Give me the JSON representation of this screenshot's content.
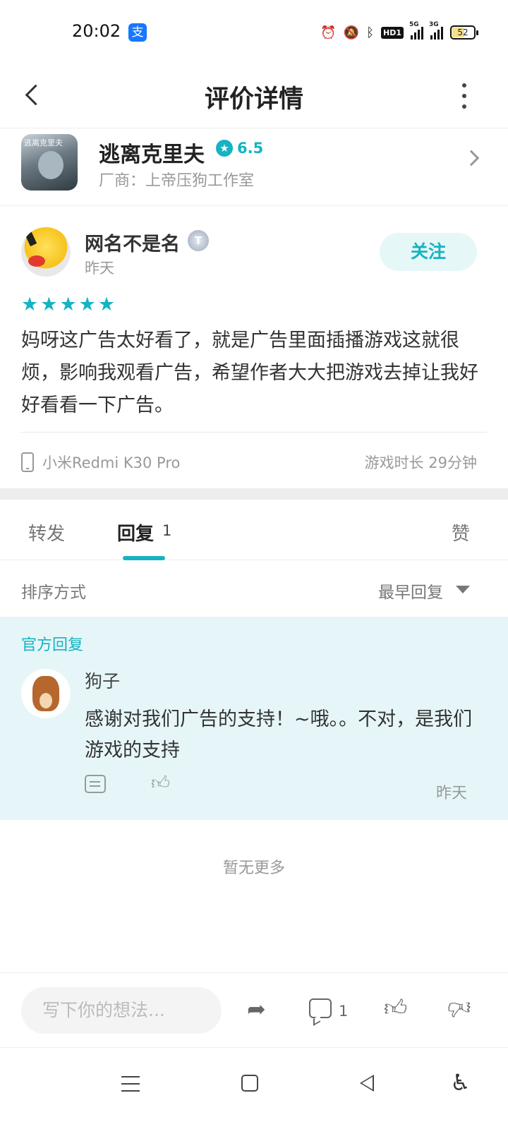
{
  "status_bar": {
    "time": "20:02",
    "app_badge": "支",
    "hd_label": "HD1",
    "sig1_label": "5G",
    "sig2_label": "3G",
    "battery": "52"
  },
  "header": {
    "title": "评价详情"
  },
  "game": {
    "name": "逃离克里夫",
    "rating": "6.5",
    "vendor": "厂商：上帝压狗工作室",
    "icon_text": "逃离克里夫"
  },
  "review": {
    "username": "网名不是名",
    "badge": "T",
    "date": "昨天",
    "follow_label": "关注",
    "stars": 5,
    "content": "妈呀这广告太好看了，就是广告里面插播游戏这就很烦，影响我观看广告，希望作者大大把游戏去掉让我好好看看一下广告。",
    "device": "小米Redmi K30 Pro",
    "playtime": "游戏时长 29分钟"
  },
  "tabs": {
    "forward": "转发",
    "reply": "回复",
    "reply_count": "1",
    "like": "赞"
  },
  "sort": {
    "label": "排序方式",
    "value": "最早回复"
  },
  "official_reply": {
    "label": "官方回复",
    "name": "狗子",
    "text": "感谢对我们广告的支持！~哦。。不对，是我们游戏的支持",
    "date": "昨天"
  },
  "no_more": "暂无更多",
  "action_bar": {
    "input_placeholder": "写下你的想法...",
    "comment_count": "1"
  },
  "colors": {
    "accent": "#15b3c3",
    "official_bg": "#e6f6f8"
  }
}
